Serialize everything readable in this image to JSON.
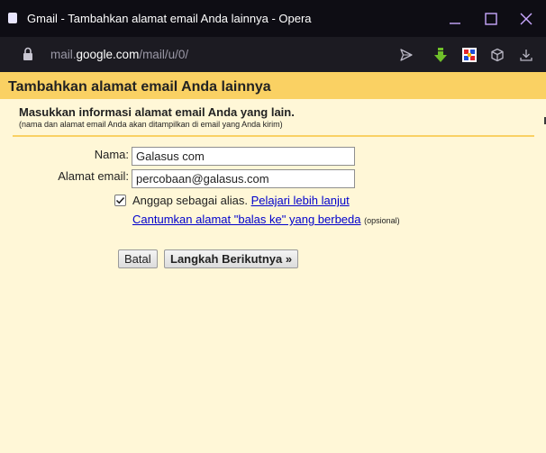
{
  "window": {
    "title": "Gmail - Tambahkan alamat email Anda lainnya - Opera"
  },
  "addressbar": {
    "url_prefix": "mail.",
    "url_host": "google.com",
    "url_path": "/mail/u/0/"
  },
  "icons": {
    "lock": "lock-icon",
    "send": "send-icon",
    "download_green": "download-arrow-icon",
    "extension": "extension-icon",
    "cube": "cube-icon",
    "downloads": "downloads-icon"
  },
  "colors": {
    "header_bg": "#fad163",
    "page_bg": "#fff7d7",
    "link": "#0000cc",
    "titlebar_bg": "#0e0d14",
    "addressbar_bg": "#1c1b22"
  },
  "page": {
    "title": "Tambahkan alamat email Anda lainnya",
    "section_title": "Masukkan informasi alamat email Anda yang lain.",
    "section_note": "(nama dan alamat email Anda akan ditampilkan di email yang Anda kirim)"
  },
  "form": {
    "name_label": "Nama:",
    "name_value": "Galasus com",
    "email_label": "Alamat email:",
    "email_value": "percobaan@galasus.com",
    "alias_label": "Anggap sebagai alias.",
    "alias_checked": true,
    "learn_more_link": "Pelajari lebih lanjut",
    "reply_to_link": "Cantumkan alamat \"balas ke\" yang berbeda",
    "optional_note": "(opsional)"
  },
  "buttons": {
    "cancel": "Batal",
    "next": "Langkah Berikutnya »"
  }
}
